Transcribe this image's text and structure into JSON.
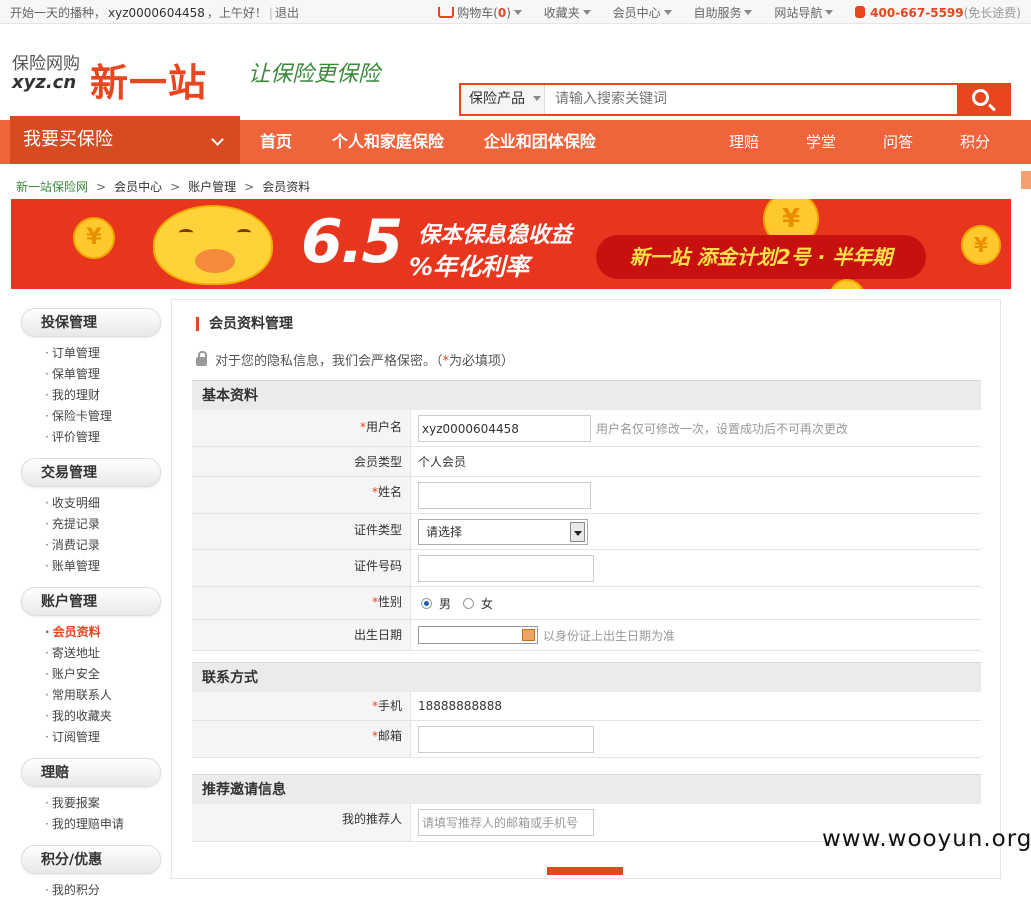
{
  "topbar": {
    "greeting": "开始一天的播种，",
    "username": "xyz0000604458",
    "salutation": "，上午好！",
    "logout": "退出",
    "cart_label": "购物车(",
    "cart_count": "0",
    "cart_close": ")",
    "favorites": "收藏夹",
    "member_center": "会员中心",
    "self_service": "自助服务",
    "site_nav": "网站导航",
    "phone": "400-667-5599",
    "phone_note": "(免长途费)"
  },
  "header": {
    "logo_small": "保险网购",
    "logo_domain": "xyz.cn",
    "logo_big": "新一站",
    "slogan": "让保险更保险",
    "search_category": "保险产品",
    "search_placeholder": "请输入搜索关键词"
  },
  "nav": {
    "buy": "我要买保险",
    "links": [
      "首页",
      "个人和家庭保险",
      "企业和团体保险"
    ],
    "right_links": [
      "理赔",
      "学堂",
      "问答",
      "积分"
    ]
  },
  "breadcrumb": [
    "新一站保险网",
    "会员中心",
    "账户管理",
    "会员资料"
  ],
  "banner": {
    "rate": "6.5",
    "text1": "保本保息稳收益",
    "text2": "%年化利率",
    "plan": "新一站 添金计划2号 · 半年期"
  },
  "sidebar": [
    {
      "title": "投保管理",
      "items": [
        "订单管理",
        "保单管理",
        "我的理财",
        "保险卡管理",
        "评价管理"
      ]
    },
    {
      "title": "交易管理",
      "items": [
        "收支明细",
        "充提记录",
        "消费记录",
        "账单管理"
      ]
    },
    {
      "title": "账户管理",
      "items": [
        "会员资料",
        "寄送地址",
        "账户安全",
        "常用联系人",
        "我的收藏夹",
        "订阅管理"
      ],
      "active": "会员资料"
    },
    {
      "title": "理赔",
      "items": [
        "我要报案",
        "我的理赔申请"
      ]
    },
    {
      "title": "积分/优惠",
      "items": [
        "我的积分"
      ]
    }
  ],
  "main": {
    "title": "会员资料管理",
    "privacy_note": "对于您的隐私信息，我们会严格保密。（",
    "required_star": "*",
    "required_note": "为必填项）",
    "basic": {
      "heading": "基本资料",
      "username_label": "用户名",
      "username_value": "xyz0000604458",
      "username_hint": "用户名仅可修改一次，设置成功后不可再次更改",
      "member_type_label": "会员类型",
      "member_type_value": "个人会员",
      "name_label": "姓名",
      "id_type_label": "证件类型",
      "id_type_value": "请选择",
      "id_number_label": "证件号码",
      "gender_label": "性别",
      "gender_male": "男",
      "gender_female": "女",
      "birth_label": "出生日期",
      "birth_hint": "以身份证上出生日期为准"
    },
    "contact": {
      "heading": "联系方式",
      "mobile_label": "手机",
      "mobile_value": "18888888888",
      "email_label": "邮箱"
    },
    "referral": {
      "heading": "推荐邀请信息",
      "referrer_label": "我的推荐人",
      "referrer_placeholder": "请填写推荐人的邮箱或手机号"
    }
  },
  "watermark": "www.wooyun.org",
  "colors": {
    "accent": "#e8461e",
    "nav": "#f0643c",
    "link_green": "#3a8a3a"
  }
}
